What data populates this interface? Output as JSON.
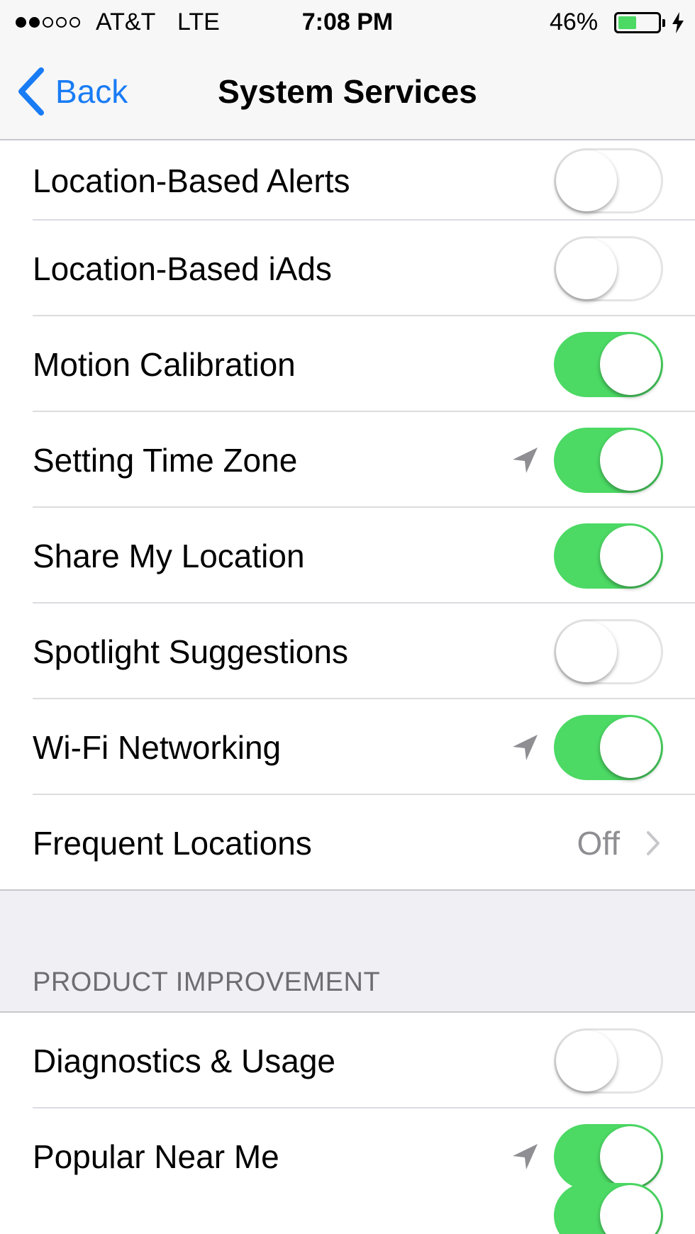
{
  "status_bar": {
    "carrier": "AT&T",
    "network": "LTE",
    "time": "7:08 PM",
    "battery_percent": "46%",
    "battery_level": 0.46,
    "signal_strength": "2 of 5",
    "charging_icon": "bolt-icon"
  },
  "nav": {
    "back_label": "Back",
    "title": "System Services"
  },
  "colors": {
    "accent": "#1a7cf5",
    "toggle_on": "#4cd964",
    "section_background": "#efeff4"
  },
  "rows": [
    {
      "label": "Location-Based Alerts",
      "state": "off"
    },
    {
      "label": "Location-Based iAds",
      "state": "off"
    },
    {
      "label": "Motion Calibration",
      "state": "on"
    },
    {
      "label": "Setting Time Zone",
      "state": "on",
      "location_icon": "location-arrow-icon"
    },
    {
      "label": "Share My Location",
      "state": "on"
    },
    {
      "label": "Spotlight Suggestions",
      "state": "off"
    },
    {
      "label": "Wi-Fi Networking",
      "state": "on",
      "location_icon": "location-arrow-icon"
    },
    {
      "label": "Frequent Locations",
      "value": "Off",
      "disclosure_icon": "chevron-right-icon"
    }
  ],
  "product_improvement": {
    "header": "PRODUCT IMPROVEMENT",
    "rows": [
      {
        "label": "Diagnostics & Usage",
        "state": "off"
      },
      {
        "label": "Popular Near Me",
        "state": "on",
        "location_icon": "location-arrow-icon"
      },
      {
        "label": "",
        "state": "on"
      }
    ]
  }
}
